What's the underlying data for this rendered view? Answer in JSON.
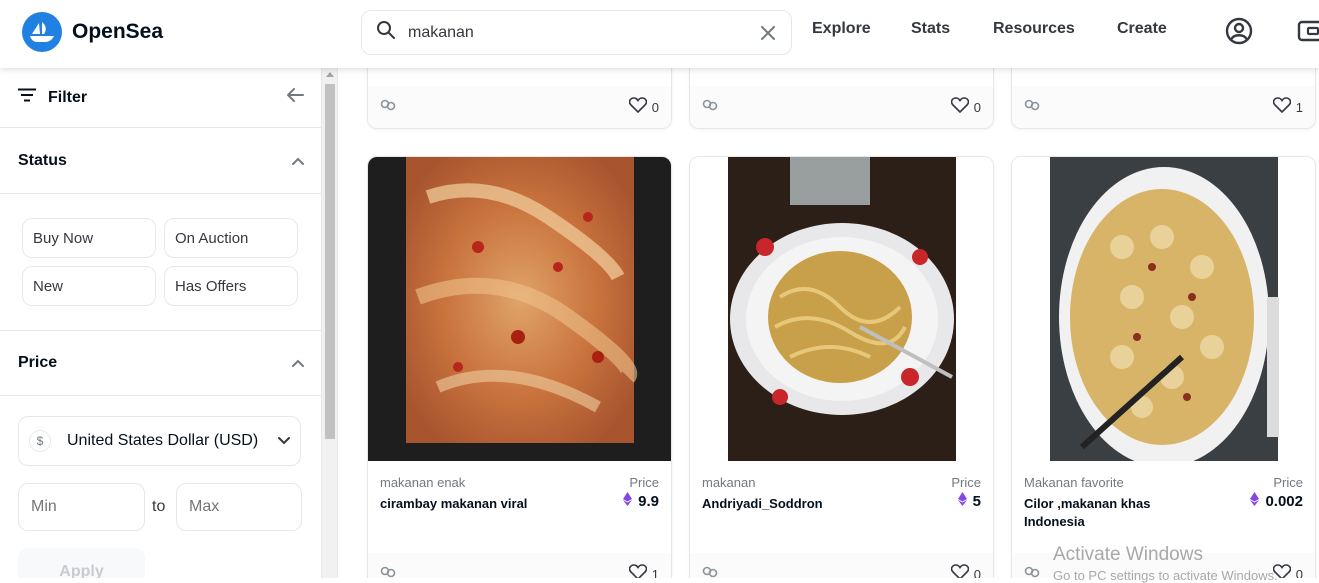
{
  "header": {
    "brand": "OpenSea",
    "search_value": "makanan",
    "nav": [
      "Explore",
      "Stats",
      "Resources",
      "Create"
    ]
  },
  "sidebar": {
    "filter_label": "Filter",
    "status": {
      "title": "Status",
      "options": [
        "Buy Now",
        "On Auction",
        "New",
        "Has Offers"
      ]
    },
    "price": {
      "title": "Price",
      "currency_symbol": "$",
      "currency": "United States Dollar (USD)",
      "min_placeholder": "Min",
      "to_label": "to",
      "max_placeholder": "Max",
      "apply_label": "Apply"
    }
  },
  "top_cards": [
    {
      "favorites": "0"
    },
    {
      "favorites": "0"
    },
    {
      "favorites": "1"
    }
  ],
  "cards": [
    {
      "collection": "makanan enak",
      "name": "cirambay makanan viral",
      "price_label": "Price",
      "price": "9.9",
      "favorites": "1"
    },
    {
      "collection": "makanan",
      "name": "Andriyadi_Soddron",
      "price_label": "Price",
      "price": "5",
      "favorites": "0"
    },
    {
      "collection": "Makanan favorite",
      "name": "Cilor ,makanan khas Indonesia",
      "price_label": "Price",
      "price": "0.002",
      "favorites": "0"
    }
  ],
  "overlay": {
    "title": "Activate Windows",
    "subtitle": "Go to PC settings to activate Windows."
  },
  "colors": {
    "brand": "#2081e2",
    "eth": "#8247e5"
  }
}
